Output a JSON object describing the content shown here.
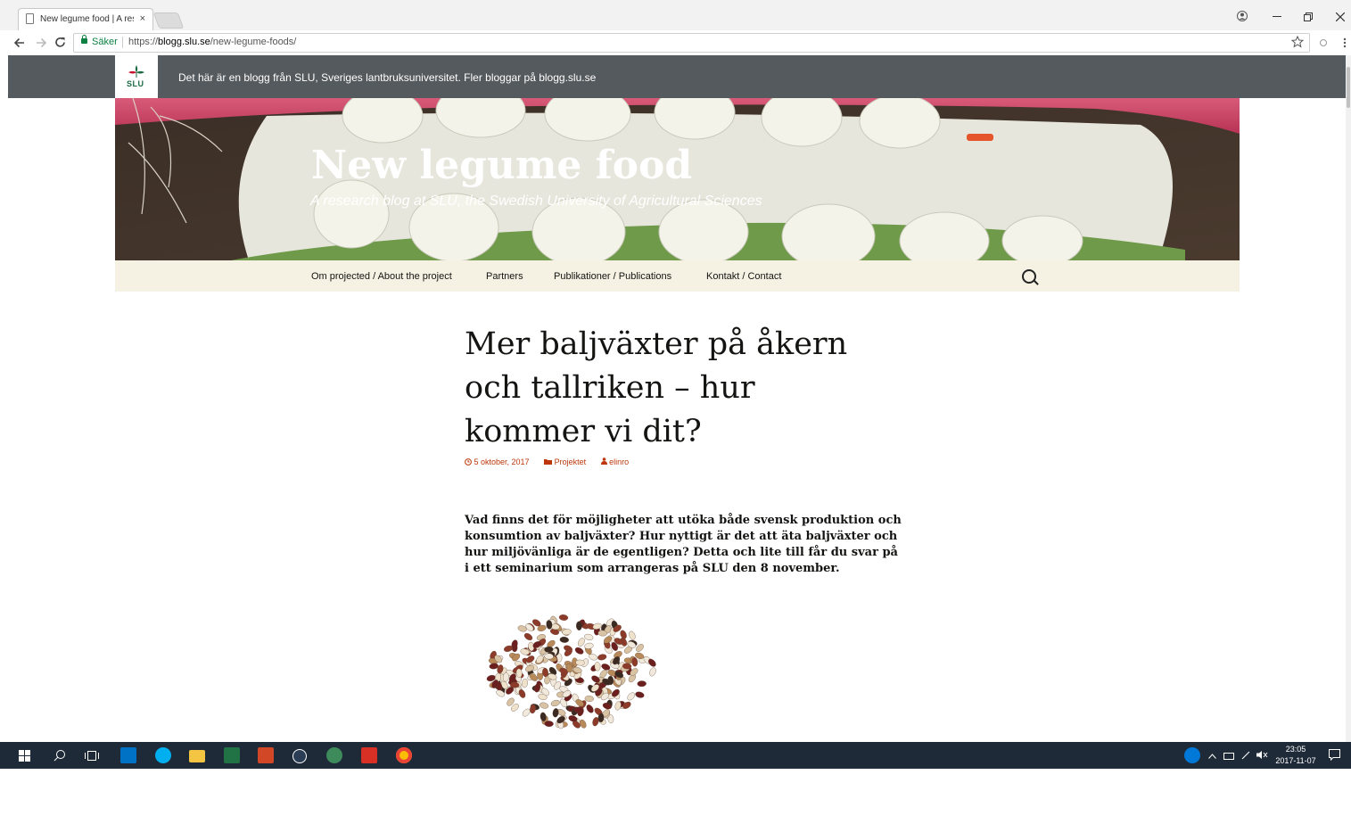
{
  "browser": {
    "tab_title": "New legume food | A res",
    "tab_close": "×",
    "secure_label": "Säker",
    "url_scheme": "https://",
    "url_host": "blogg.slu.se",
    "url_path": "/new-legume-foods/"
  },
  "slu_bar": {
    "logo_text": "SLU",
    "tagline": "Det här är en blogg från SLU, Sveriges lantbruksuniversitet. Fler bloggar på blogg.slu.se"
  },
  "site": {
    "title": "New legume food",
    "description": "A research blog at SLU, the Swedish University of Agricultural Sciences"
  },
  "nav": {
    "items": [
      {
        "label": "Om projected / About the project"
      },
      {
        "label": "Partners"
      },
      {
        "label": "Publikationer / Publications"
      },
      {
        "label": "Kontakt / Contact"
      }
    ]
  },
  "post": {
    "title": "Mer baljväxter på åkern och tallriken – hur kommer vi dit?",
    "date": "5 oktober, 2017",
    "category": "Projektet",
    "author": "elinro",
    "lead": "Vad finns det för möjligheter att utöka både svensk produktion och konsumtion av baljväxter? Hur nyttigt är det att äta baljväxter och hur miljövänliga är de egentligen? Detta och lite till får du svar på i ett seminarium som arrangeras på SLU den 8 november."
  },
  "taskbar": {
    "time": "23:05",
    "date": "2017-11-07",
    "icons": [
      "windows-start",
      "search",
      "task-view",
      "outlook",
      "skype",
      "file-explorer",
      "excel",
      "powerpoint",
      "browser",
      "app",
      "acrobat",
      "chrome"
    ]
  },
  "colors": {
    "slu_bar": "#555a5e",
    "nav_bg": "#f5f1e3",
    "meta_link": "#bc360a",
    "taskbar": "#1f2a38"
  }
}
